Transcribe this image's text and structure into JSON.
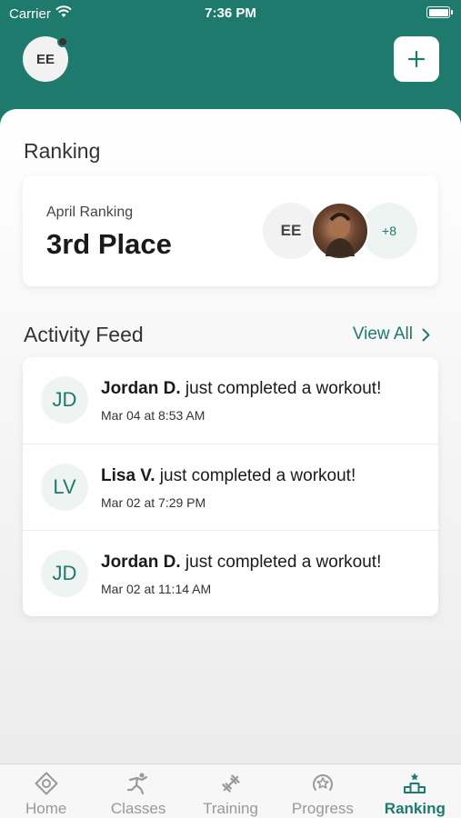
{
  "status_bar": {
    "carrier": "Carrier",
    "time": "7:36 PM"
  },
  "header": {
    "avatar_initials": "EE"
  },
  "ranking": {
    "section_title": "Ranking",
    "label": "April Ranking",
    "value": "3rd Place",
    "avatars": [
      {
        "type": "initials",
        "text": "EE"
      },
      {
        "type": "photo",
        "icon": "person-photo"
      },
      {
        "type": "more",
        "text": "+8"
      }
    ]
  },
  "activity_feed": {
    "section_title": "Activity Feed",
    "view_all_label": "View All",
    "items": [
      {
        "initials": "JD",
        "name": "Jordan D.",
        "action": " just completed a workout!",
        "time": "Mar 04 at 8:53 AM"
      },
      {
        "initials": "LV",
        "name": "Lisa V.",
        "action": " just completed a workout!",
        "time": "Mar 02 at 7:29 PM"
      },
      {
        "initials": "JD",
        "name": "Jordan D.",
        "action": " just completed a workout!",
        "time": "Mar 02 at 11:14 AM"
      }
    ]
  },
  "tabs": [
    {
      "label": "Home",
      "icon": "home-icon",
      "active": false
    },
    {
      "label": "Classes",
      "icon": "classes-icon",
      "active": false
    },
    {
      "label": "Training",
      "icon": "training-icon",
      "active": false
    },
    {
      "label": "Progress",
      "icon": "progress-icon",
      "active": false
    },
    {
      "label": "Ranking",
      "icon": "ranking-icon",
      "active": true
    }
  ],
  "colors": {
    "brand": "#1e7a6c",
    "inactive_tab": "#999999"
  }
}
